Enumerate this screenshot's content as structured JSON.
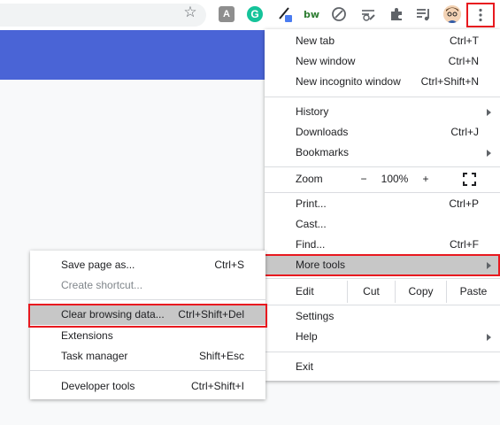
{
  "toolbar": {
    "bookmark_icon": "star-icon",
    "extensions": [
      {
        "name": "pdf-extension-icon",
        "glyph": "A"
      },
      {
        "name": "grammarly-icon",
        "glyph": "G"
      },
      {
        "name": "eyedropper-icon",
        "glyph": ""
      },
      {
        "name": "bw-icon",
        "glyph": "bw"
      },
      {
        "name": "blocker-icon",
        "glyph": ""
      },
      {
        "name": "tools-icon",
        "glyph": ""
      },
      {
        "name": "puzzle-icon",
        "glyph": ""
      },
      {
        "name": "queue-music-icon",
        "glyph": ""
      },
      {
        "name": "avatar",
        "glyph": ""
      }
    ],
    "menu_icon": "three-dot-menu-icon"
  },
  "menu": {
    "new_tab": {
      "label": "New tab",
      "shortcut": "Ctrl+T"
    },
    "new_window": {
      "label": "New window",
      "shortcut": "Ctrl+N"
    },
    "new_incognito": {
      "label": "New incognito window",
      "shortcut": "Ctrl+Shift+N"
    },
    "history": {
      "label": "History"
    },
    "downloads": {
      "label": "Downloads",
      "shortcut": "Ctrl+J"
    },
    "bookmarks": {
      "label": "Bookmarks"
    },
    "zoom": {
      "label": "Zoom",
      "minus": "−",
      "value": "100%",
      "plus": "+"
    },
    "print": {
      "label": "Print...",
      "shortcut": "Ctrl+P"
    },
    "cast": {
      "label": "Cast..."
    },
    "find": {
      "label": "Find...",
      "shortcut": "Ctrl+F"
    },
    "more_tools": {
      "label": "More tools"
    },
    "edit": {
      "label": "Edit",
      "cut": "Cut",
      "copy": "Copy",
      "paste": "Paste"
    },
    "settings": {
      "label": "Settings"
    },
    "help": {
      "label": "Help"
    },
    "exit": {
      "label": "Exit"
    }
  },
  "submenu": {
    "save_page": {
      "label": "Save page as...",
      "shortcut": "Ctrl+S"
    },
    "create_shortcut": {
      "label": "Create shortcut..."
    },
    "clear_browsing": {
      "label": "Clear browsing data...",
      "shortcut": "Ctrl+Shift+Del"
    },
    "extensions": {
      "label": "Extensions"
    },
    "task_manager": {
      "label": "Task manager",
      "shortcut": "Shift+Esc"
    },
    "developer_tools": {
      "label": "Developer tools",
      "shortcut": "Ctrl+Shift+I"
    }
  },
  "colors": {
    "highlight_box": "#e8191f",
    "hover_row": "#c7c7c7",
    "banner": "#4a64d6"
  }
}
